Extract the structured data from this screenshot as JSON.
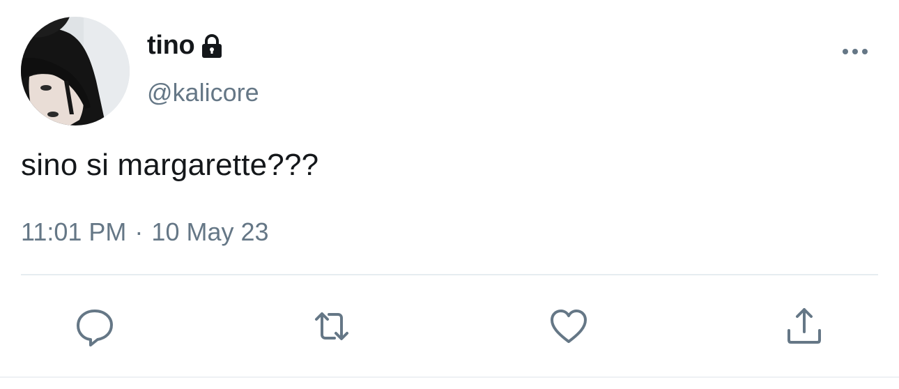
{
  "tweet": {
    "author": {
      "display_name": "tino",
      "handle": "@kalicore",
      "protected_icon": "lock-icon",
      "avatar_icon": "profile-photo"
    },
    "text": "sino si margarette???",
    "time": "11:01 PM",
    "separator": "·",
    "date": "10 May 23",
    "more_icon": "more-horizontal-icon"
  },
  "actions": [
    {
      "name": "reply",
      "icon": "reply-icon"
    },
    {
      "name": "retweet",
      "icon": "retweet-icon"
    },
    {
      "name": "like",
      "icon": "heart-icon"
    },
    {
      "name": "share",
      "icon": "share-icon"
    }
  ],
  "colors": {
    "text_primary": "#14171a",
    "text_secondary": "#657786",
    "icon": "#657786",
    "divider": "#e6ecf0",
    "background": "#ffffff"
  }
}
